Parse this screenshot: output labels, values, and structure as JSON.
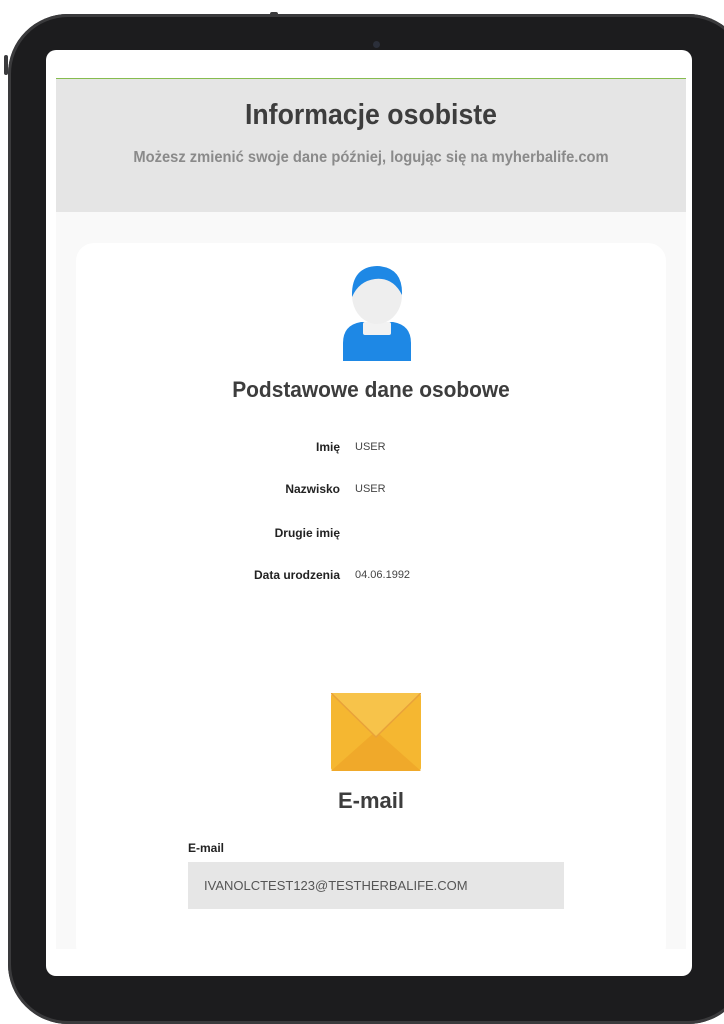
{
  "header": {
    "title": "Informacje osobiste",
    "subtitle": "Możesz zmienić swoje dane później, logując się na myherbalife.com"
  },
  "basic_info": {
    "icon": "user-avatar-icon",
    "title": "Podstawowe dane osobowe",
    "fields": [
      {
        "label": "Imię",
        "value": "USER"
      },
      {
        "label": "Nazwisko",
        "value": "USER"
      },
      {
        "label": "Drugie imię",
        "value": ""
      },
      {
        "label": "Data urodzenia",
        "value": "04.06.1992"
      }
    ]
  },
  "email_section": {
    "icon": "envelope-icon",
    "title": "E-mail",
    "field_label": "E-mail",
    "field_value": "IVANOLCTEST123@TESTHERBALIFE.COM"
  },
  "colors": {
    "accent_line": "#86bc4f",
    "avatar_blue": "#1e88e5",
    "envelope_yellow": "#f5b731",
    "header_bg": "#e5e5e5"
  }
}
